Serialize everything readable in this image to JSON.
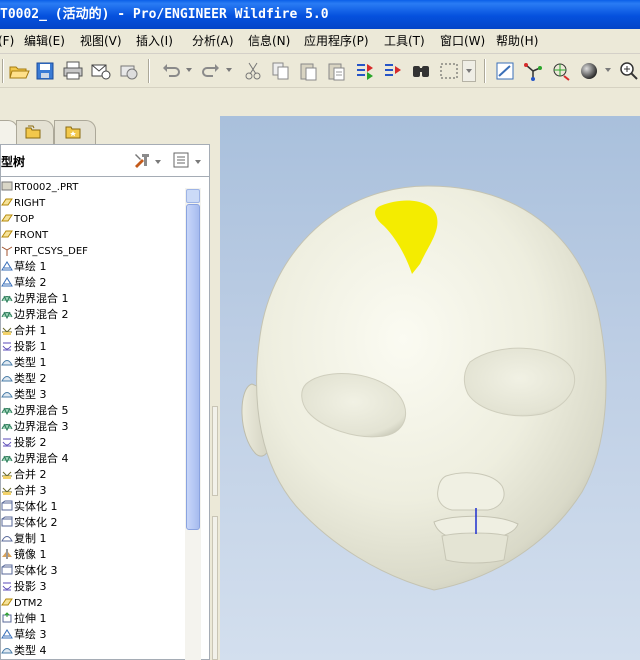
{
  "window": {
    "title": "T0002_ (活动的) - Pro/ENGINEER Wildfire 5.0"
  },
  "menubar": {
    "items": [
      {
        "label": "文件(F)",
        "id": "file"
      },
      {
        "label": "编辑(E)",
        "id": "edit"
      },
      {
        "label": "视图(V)",
        "id": "view"
      },
      {
        "label": "插入(I)",
        "id": "insert"
      },
      {
        "label": "分析(A)",
        "id": "analysis"
      },
      {
        "label": "信息(N)",
        "id": "info"
      },
      {
        "label": "应用程序(P)",
        "id": "applications"
      },
      {
        "label": "工具(T)",
        "id": "tools"
      },
      {
        "label": "窗口(W)",
        "id": "window"
      },
      {
        "label": "帮助(H)",
        "id": "help"
      }
    ]
  },
  "toolbar": {
    "buttons": [
      "open-icon",
      "save-icon",
      "print-icon",
      "mail-icon",
      "send-icon",
      "undo-icon",
      "redo-icon",
      "cut-icon",
      "copy-icon",
      "paste-icon",
      "paste-special-icon",
      "regenerate-icon",
      "regenerate-manager-icon",
      "find-icon",
      "select-box-icon",
      "repaint-icon",
      "spin-center-icon",
      "orient-icon",
      "shading-icon",
      "zoom-in-icon"
    ]
  },
  "model_tree": {
    "title": "型树",
    "items": [
      {
        "label": "RT0002_.PRT",
        "icon": "part-icon",
        "mono": true
      },
      {
        "label": "RIGHT",
        "icon": "datum-plane-icon",
        "mono": true
      },
      {
        "label": "TOP",
        "icon": "datum-plane-icon",
        "mono": true
      },
      {
        "label": "FRONT",
        "icon": "datum-plane-icon",
        "mono": true
      },
      {
        "label": "PRT_CSYS_DEF",
        "icon": "csys-icon",
        "mono": true
      },
      {
        "label": "草绘 1",
        "icon": "sketch-icon"
      },
      {
        "label": "草绘 2",
        "icon": "sketch-icon"
      },
      {
        "label": "边界混合 1",
        "icon": "boundary-blend-icon"
      },
      {
        "label": "边界混合 2",
        "icon": "boundary-blend-icon"
      },
      {
        "label": "合并 1",
        "icon": "merge-icon"
      },
      {
        "label": "投影 1",
        "icon": "projection-icon"
      },
      {
        "label": "类型 1",
        "icon": "type-icon"
      },
      {
        "label": "类型 2",
        "icon": "type-icon"
      },
      {
        "label": "类型 3",
        "icon": "type-icon"
      },
      {
        "label": "边界混合 5",
        "icon": "boundary-blend-icon"
      },
      {
        "label": "边界混合 3",
        "icon": "boundary-blend-icon"
      },
      {
        "label": "投影 2",
        "icon": "projection-icon"
      },
      {
        "label": "边界混合 4",
        "icon": "boundary-blend-icon"
      },
      {
        "label": "合并 2",
        "icon": "merge-icon"
      },
      {
        "label": "合并 3",
        "icon": "merge-icon"
      },
      {
        "label": "实体化 1",
        "icon": "solidify-icon"
      },
      {
        "label": "实体化 2",
        "icon": "solidify-icon"
      },
      {
        "label": "复制 1",
        "icon": "copy-feature-icon"
      },
      {
        "label": "镜像 1",
        "icon": "mirror-icon"
      },
      {
        "label": "实体化 3",
        "icon": "solidify-icon"
      },
      {
        "label": "投影 3",
        "icon": "projection-icon"
      },
      {
        "label": "DTM2",
        "icon": "datum-plane-icon",
        "mono": true
      },
      {
        "label": "拉伸 1",
        "icon": "extrude-icon"
      },
      {
        "label": "草绘 3",
        "icon": "sketch-icon"
      },
      {
        "label": "类型 4",
        "icon": "type-icon"
      }
    ]
  },
  "colors": {
    "title_bar": "#0551de",
    "viewport_top": "#a9c0dc",
    "viewport_bottom": "#d3dfee",
    "model": "#f3f3e6",
    "highlight": "#f4ec00"
  }
}
